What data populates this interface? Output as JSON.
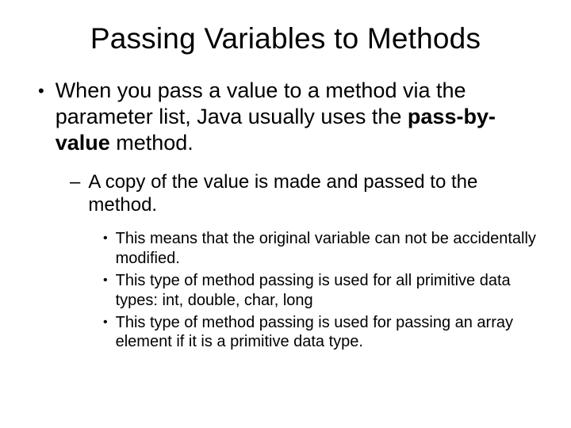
{
  "title": "Passing Variables to Methods",
  "level1": {
    "bullet": "•",
    "text_pre": "When you pass a value to a method via the parameter list, Java usually uses the ",
    "text_bold": "pass-by-value",
    "text_post": " method."
  },
  "level2": {
    "bullet": "–",
    "text": "A copy of the value is made and passed to the method."
  },
  "level3": [
    {
      "bullet": "•",
      "text": "This means that the original variable can not be accidentally modified."
    },
    {
      "bullet": "•",
      "text": "This type of method passing is used for all primitive data types: int, double, char, long"
    },
    {
      "bullet": "•",
      "text": "This type of method passing is used for passing an array element if it is a primitive data type."
    }
  ]
}
